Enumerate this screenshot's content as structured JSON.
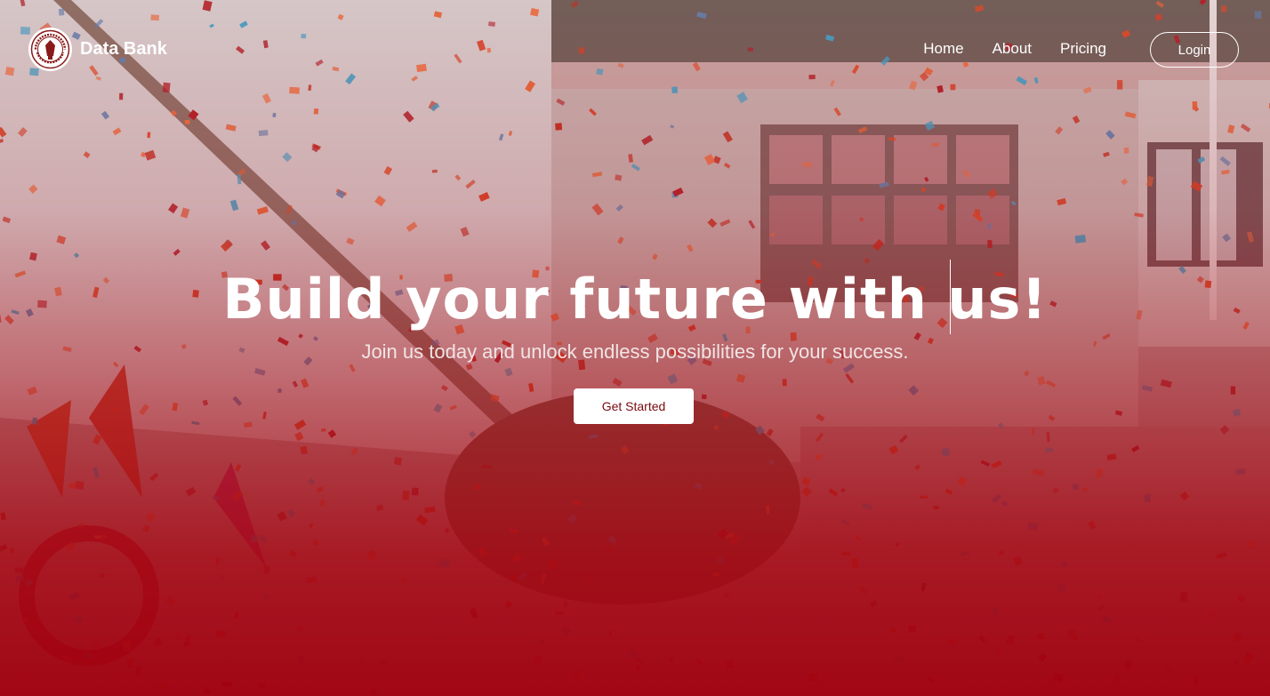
{
  "brand": {
    "name": "Data Bank",
    "logo_icon": "college-seal-icon",
    "logo_text_top": "ST. PETER'S COLLEGE",
    "logo_text_bottom": "ILIGAN CITY",
    "logo_year": "1952"
  },
  "nav": {
    "items": [
      {
        "label": "Home"
      },
      {
        "label": "About"
      },
      {
        "label": "Pricing"
      }
    ],
    "login_label": "Login"
  },
  "hero": {
    "title": "Build your future with us!",
    "subtitle": "Join us today and unlock endless possibilities for your success.",
    "cta_label": "Get Started"
  },
  "colors": {
    "accent_red": "#a5000f",
    "text_white": "#ffffff",
    "cta_text": "#7a0a10"
  }
}
